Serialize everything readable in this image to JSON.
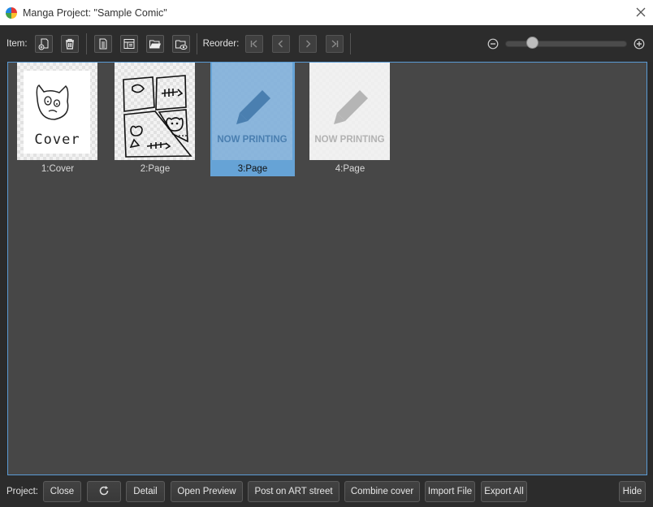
{
  "window": {
    "title": "Manga Project: \"Sample Comic\""
  },
  "toolbar": {
    "item_label": "Item:",
    "reorder_label": "Reorder:",
    "item_buttons": [
      "add-page-icon",
      "trash-icon",
      "page-settings-icon",
      "multi-page-icon",
      "open-folder-icon",
      "open-preview-icon"
    ],
    "reorder_buttons": [
      "first-icon",
      "prev-icon",
      "next-icon",
      "last-icon"
    ],
    "zoom_level": 0.22
  },
  "pages": [
    {
      "label": "1:Cover",
      "kind": "cover",
      "selected": false
    },
    {
      "label": "2:Page",
      "kind": "comic",
      "selected": false
    },
    {
      "label": "3:Page",
      "kind": "now-printing",
      "selected": true,
      "placeholder": "NOW PRINTING"
    },
    {
      "label": "4:Page",
      "kind": "now-printing",
      "selected": false,
      "placeholder": "NOW PRINTING"
    }
  ],
  "cover_text": "Cover",
  "project": {
    "label": "Project:",
    "buttons": {
      "close": "Close",
      "detail": "Detail",
      "open_preview": "Open Preview",
      "post_art_street": "Post on ART street",
      "combine_cover": "Combine cover",
      "import_file": "Import File",
      "export_all": "Export All",
      "hide": "Hide"
    }
  },
  "colors": {
    "selection": "#66a3d6",
    "accent_border": "#5a9bd5",
    "panel": "#474747"
  }
}
